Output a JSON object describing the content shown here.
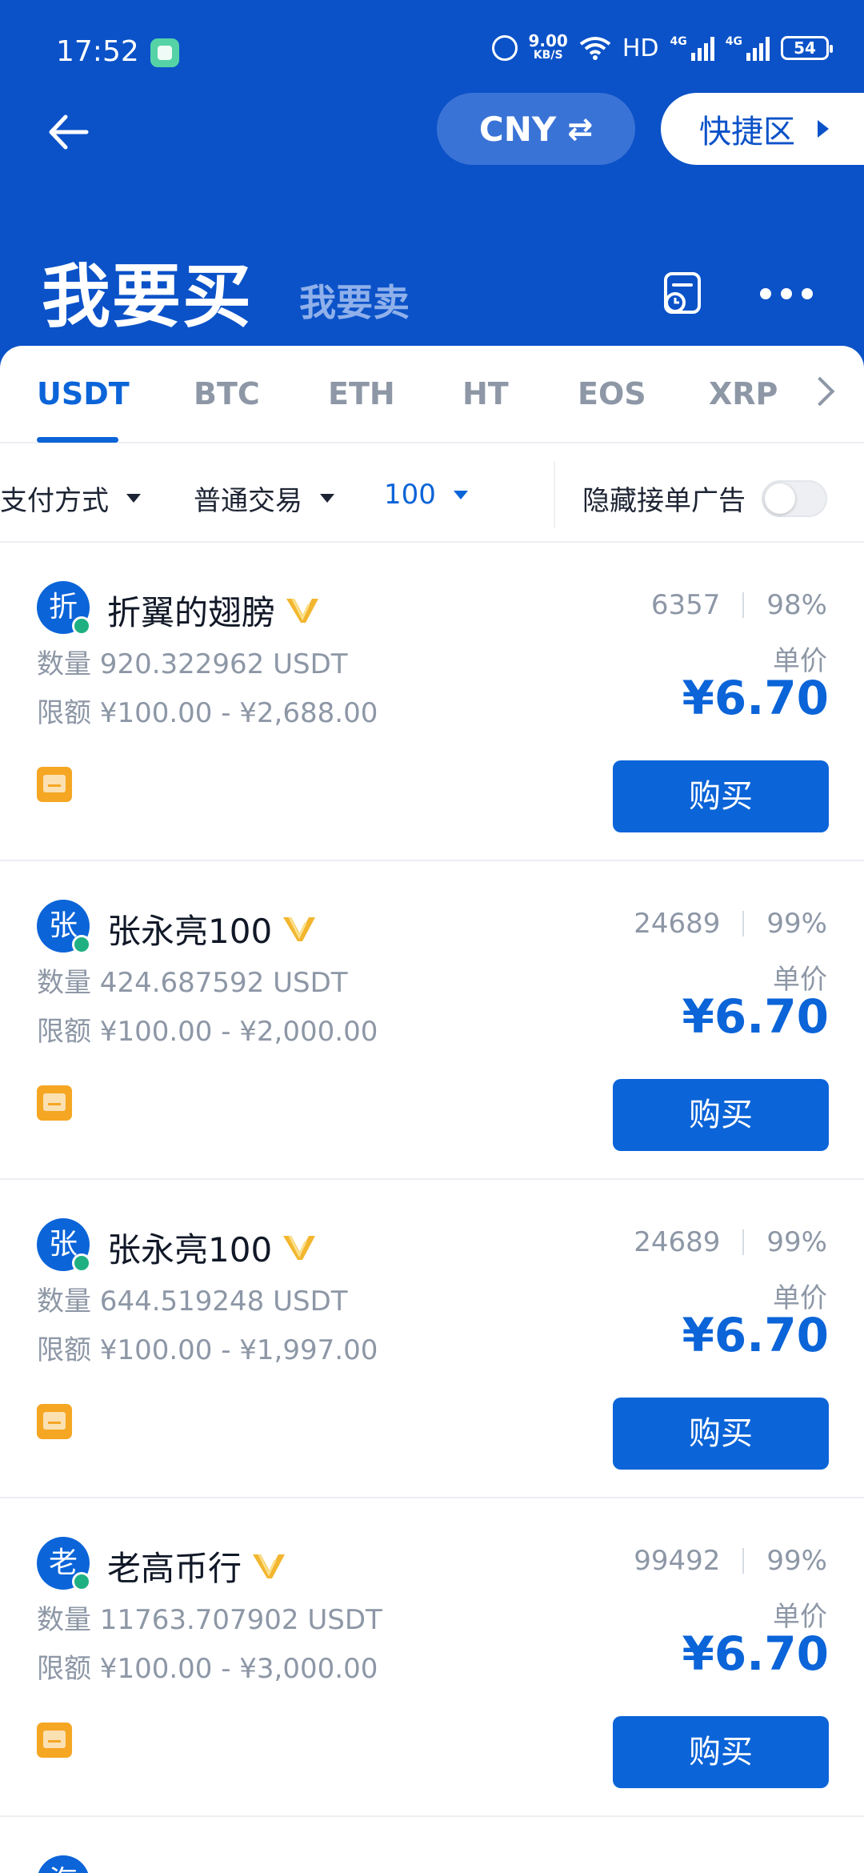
{
  "status_bar": {
    "time": "17:52",
    "net_speed": "9.00",
    "net_unit": "KB/S",
    "hd": "HD",
    "net1": "4G",
    "net2": "4G",
    "battery": "54"
  },
  "header": {
    "currency": "CNY",
    "quick_zone": "快捷区",
    "buy_title": "我要买",
    "sell_title": "我要卖"
  },
  "tabs": [
    "USDT",
    "BTC",
    "ETH",
    "HT",
    "EOS",
    "XRP"
  ],
  "active_tab": "USDT",
  "filters": {
    "payment": "支付方式",
    "trade_type": "普通交易",
    "amount": "100",
    "hide_label": "隐藏接单广告",
    "hide_enabled": false
  },
  "listings": [
    {
      "avatar": "折",
      "name": "折翼的翅膀",
      "orders": "6357",
      "rate": "98%",
      "qty": "数量 920.322962  USDT",
      "limit": "限额 ¥100.00 - ¥2,688.00",
      "unit_label": "单价",
      "price": "¥6.70",
      "button": "购买"
    },
    {
      "avatar": "张",
      "name": "张永亮100",
      "orders": "24689",
      "rate": "99%",
      "qty": "数量 424.687592  USDT",
      "limit": "限额 ¥100.00 - ¥2,000.00",
      "unit_label": "单价",
      "price": "¥6.70",
      "button": "购买"
    },
    {
      "avatar": "张",
      "name": "张永亮100",
      "orders": "24689",
      "rate": "99%",
      "qty": "数量 644.519248  USDT",
      "limit": "限额 ¥100.00 - ¥1,997.00",
      "unit_label": "单价",
      "price": "¥6.70",
      "button": "购买"
    },
    {
      "avatar": "老",
      "name": "老高币行",
      "orders": "99492",
      "rate": "99%",
      "qty": "数量 11763.707902  USDT",
      "limit": "限额 ¥100.00 - ¥3,000.00",
      "unit_label": "单价",
      "price": "¥6.70",
      "button": "购买"
    },
    {
      "avatar": "海",
      "name": "",
      "orders": "",
      "rate": "",
      "qty": "",
      "limit": "",
      "unit_label": "",
      "price": "",
      "button": ""
    }
  ],
  "colors": {
    "brand_blue": "#0b52c8",
    "accent_blue": "#0b64d8",
    "online_green": "#1fb082",
    "pay_orange": "#f5a623"
  }
}
